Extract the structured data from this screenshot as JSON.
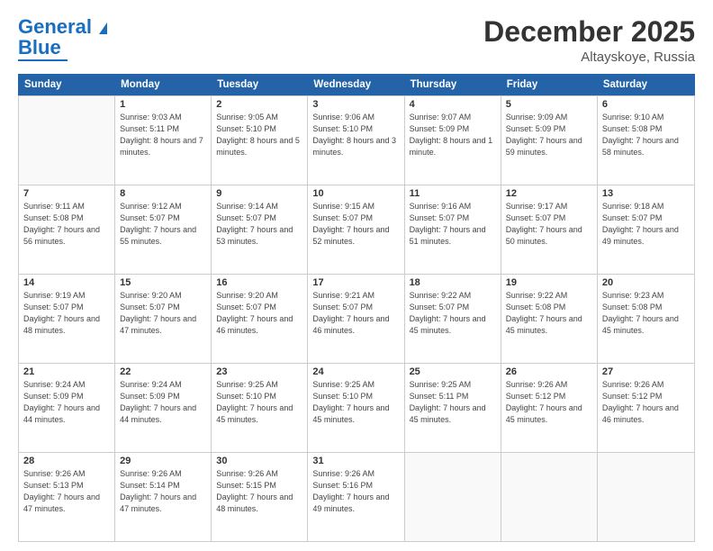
{
  "header": {
    "logo_line1": "General",
    "logo_line2": "Blue",
    "main_title": "December 2025",
    "subtitle": "Altayskoye, Russia"
  },
  "calendar": {
    "days_of_week": [
      "Sunday",
      "Monday",
      "Tuesday",
      "Wednesday",
      "Thursday",
      "Friday",
      "Saturday"
    ],
    "weeks": [
      [
        {
          "day": "",
          "empty": true
        },
        {
          "day": "1",
          "sunrise": "9:03 AM",
          "sunset": "5:11 PM",
          "daylight": "8 hours and 7 minutes."
        },
        {
          "day": "2",
          "sunrise": "9:05 AM",
          "sunset": "5:10 PM",
          "daylight": "8 hours and 5 minutes."
        },
        {
          "day": "3",
          "sunrise": "9:06 AM",
          "sunset": "5:10 PM",
          "daylight": "8 hours and 3 minutes."
        },
        {
          "day": "4",
          "sunrise": "9:07 AM",
          "sunset": "5:09 PM",
          "daylight": "8 hours and 1 minute."
        },
        {
          "day": "5",
          "sunrise": "9:09 AM",
          "sunset": "5:09 PM",
          "daylight": "7 hours and 59 minutes."
        },
        {
          "day": "6",
          "sunrise": "9:10 AM",
          "sunset": "5:08 PM",
          "daylight": "7 hours and 58 minutes."
        }
      ],
      [
        {
          "day": "7",
          "sunrise": "9:11 AM",
          "sunset": "5:08 PM",
          "daylight": "7 hours and 56 minutes."
        },
        {
          "day": "8",
          "sunrise": "9:12 AM",
          "sunset": "5:07 PM",
          "daylight": "7 hours and 55 minutes."
        },
        {
          "day": "9",
          "sunrise": "9:14 AM",
          "sunset": "5:07 PM",
          "daylight": "7 hours and 53 minutes."
        },
        {
          "day": "10",
          "sunrise": "9:15 AM",
          "sunset": "5:07 PM",
          "daylight": "7 hours and 52 minutes."
        },
        {
          "day": "11",
          "sunrise": "9:16 AM",
          "sunset": "5:07 PM",
          "daylight": "7 hours and 51 minutes."
        },
        {
          "day": "12",
          "sunrise": "9:17 AM",
          "sunset": "5:07 PM",
          "daylight": "7 hours and 50 minutes."
        },
        {
          "day": "13",
          "sunrise": "9:18 AM",
          "sunset": "5:07 PM",
          "daylight": "7 hours and 49 minutes."
        }
      ],
      [
        {
          "day": "14",
          "sunrise": "9:19 AM",
          "sunset": "5:07 PM",
          "daylight": "7 hours and 48 minutes."
        },
        {
          "day": "15",
          "sunrise": "9:20 AM",
          "sunset": "5:07 PM",
          "daylight": "7 hours and 47 minutes."
        },
        {
          "day": "16",
          "sunrise": "9:20 AM",
          "sunset": "5:07 PM",
          "daylight": "7 hours and 46 minutes."
        },
        {
          "day": "17",
          "sunrise": "9:21 AM",
          "sunset": "5:07 PM",
          "daylight": "7 hours and 46 minutes."
        },
        {
          "day": "18",
          "sunrise": "9:22 AM",
          "sunset": "5:07 PM",
          "daylight": "7 hours and 45 minutes."
        },
        {
          "day": "19",
          "sunrise": "9:22 AM",
          "sunset": "5:08 PM",
          "daylight": "7 hours and 45 minutes."
        },
        {
          "day": "20",
          "sunrise": "9:23 AM",
          "sunset": "5:08 PM",
          "daylight": "7 hours and 45 minutes."
        }
      ],
      [
        {
          "day": "21",
          "sunrise": "9:24 AM",
          "sunset": "5:09 PM",
          "daylight": "7 hours and 44 minutes."
        },
        {
          "day": "22",
          "sunrise": "9:24 AM",
          "sunset": "5:09 PM",
          "daylight": "7 hours and 44 minutes."
        },
        {
          "day": "23",
          "sunrise": "9:25 AM",
          "sunset": "5:10 PM",
          "daylight": "7 hours and 45 minutes."
        },
        {
          "day": "24",
          "sunrise": "9:25 AM",
          "sunset": "5:10 PM",
          "daylight": "7 hours and 45 minutes."
        },
        {
          "day": "25",
          "sunrise": "9:25 AM",
          "sunset": "5:11 PM",
          "daylight": "7 hours and 45 minutes."
        },
        {
          "day": "26",
          "sunrise": "9:26 AM",
          "sunset": "5:12 PM",
          "daylight": "7 hours and 45 minutes."
        },
        {
          "day": "27",
          "sunrise": "9:26 AM",
          "sunset": "5:12 PM",
          "daylight": "7 hours and 46 minutes."
        }
      ],
      [
        {
          "day": "28",
          "sunrise": "9:26 AM",
          "sunset": "5:13 PM",
          "daylight": "7 hours and 47 minutes."
        },
        {
          "day": "29",
          "sunrise": "9:26 AM",
          "sunset": "5:14 PM",
          "daylight": "7 hours and 47 minutes."
        },
        {
          "day": "30",
          "sunrise": "9:26 AM",
          "sunset": "5:15 PM",
          "daylight": "7 hours and 48 minutes."
        },
        {
          "day": "31",
          "sunrise": "9:26 AM",
          "sunset": "5:16 PM",
          "daylight": "7 hours and 49 minutes."
        },
        {
          "day": "",
          "empty": true
        },
        {
          "day": "",
          "empty": true
        },
        {
          "day": "",
          "empty": true
        }
      ]
    ]
  }
}
